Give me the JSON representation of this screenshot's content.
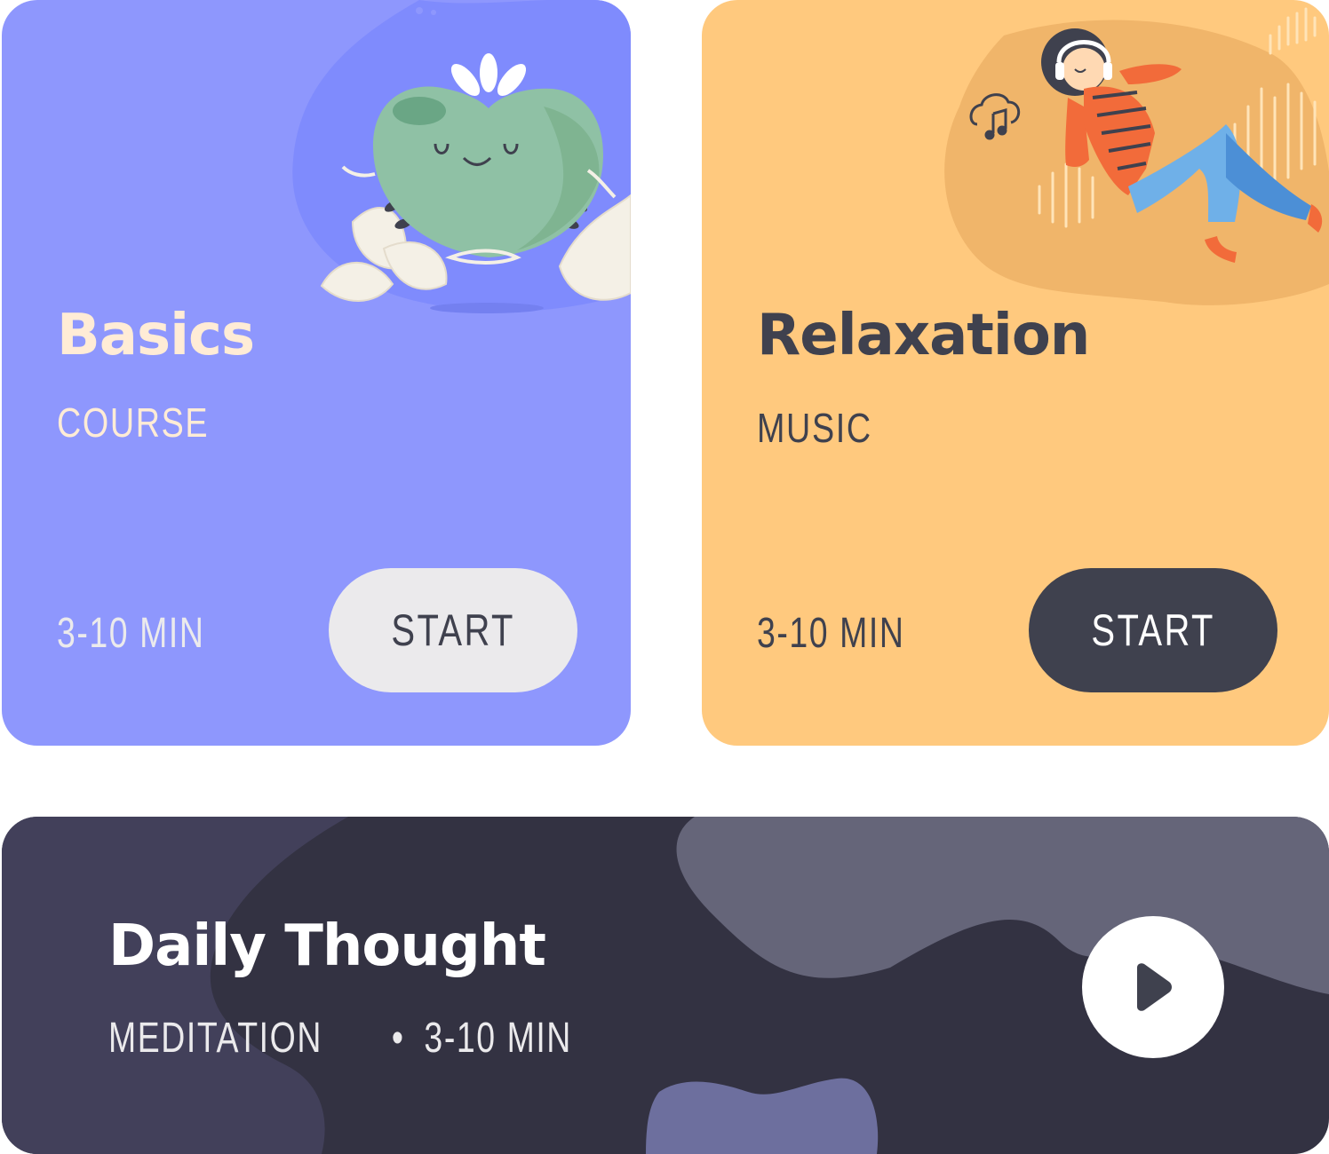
{
  "colors": {
    "basics_bg": "#8e97fd",
    "relaxation_bg": "#ffc97e",
    "daily_bg": "#333242",
    "dark_text": "#3f414e",
    "cream_text": "#ffecd6",
    "light_button": "#ebeaec"
  },
  "cards": {
    "basics": {
      "title": "Basics",
      "category": "COURSE",
      "duration": "3-10 MIN",
      "button_label": "START",
      "illustration": "meditating-heart-illustration"
    },
    "relaxation": {
      "title": "Relaxation",
      "category": "MUSIC",
      "duration": "3-10 MIN",
      "button_label": "START",
      "illustration": "woman-with-headphones-illustration"
    }
  },
  "daily": {
    "title": "Daily Thought",
    "category": "MEDITATION",
    "separator": "•",
    "duration": "3-10 MIN",
    "play_icon": "play-icon"
  }
}
